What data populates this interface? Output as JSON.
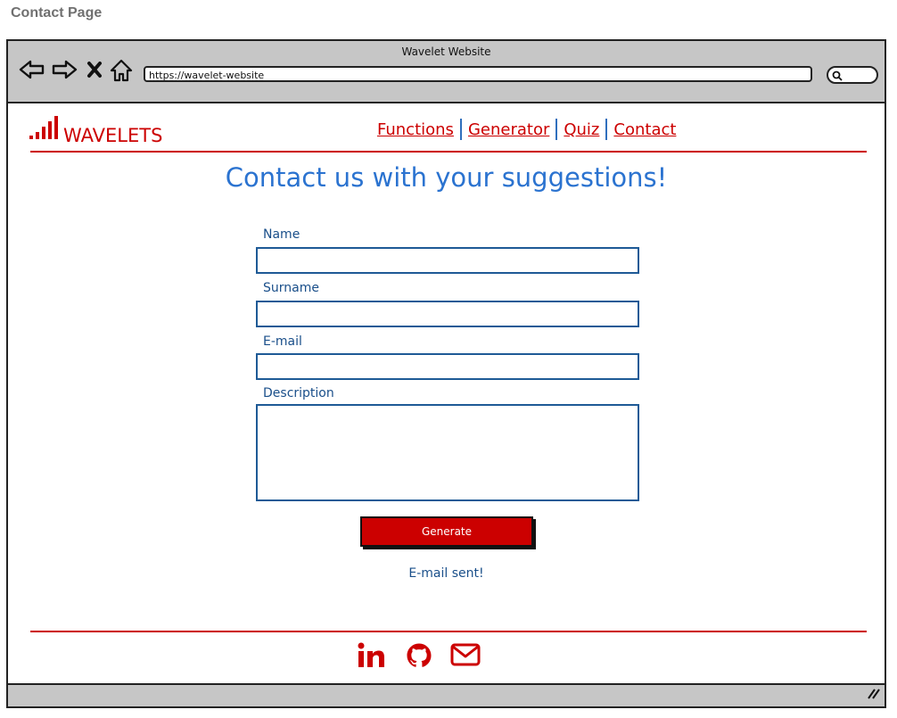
{
  "page_label": "Contact Page",
  "browser": {
    "window_title": "Wavelet Website",
    "url": "https://wavelet-website"
  },
  "site": {
    "brand": "WAVELETS",
    "nav": [
      {
        "label": "Functions"
      },
      {
        "label": "Generator"
      },
      {
        "label": "Quiz"
      },
      {
        "label": "Contact"
      }
    ]
  },
  "form": {
    "heading": "Contact us with your suggestions!",
    "fields": {
      "name": {
        "label": "Name",
        "value": ""
      },
      "surname": {
        "label": "Surname",
        "value": ""
      },
      "email": {
        "label": "E-mail",
        "value": ""
      },
      "description": {
        "label": "Description",
        "value": ""
      }
    },
    "submit_label": "Generate",
    "status": "E-mail sent!"
  },
  "footer": {
    "social": [
      "linkedin-icon",
      "github-icon",
      "mail-icon"
    ]
  },
  "colors": {
    "accent_red": "#cc0000",
    "heading_blue": "#2b73d0",
    "label_blue": "#1a4f8a",
    "chrome_gray": "#c6c6c6"
  }
}
